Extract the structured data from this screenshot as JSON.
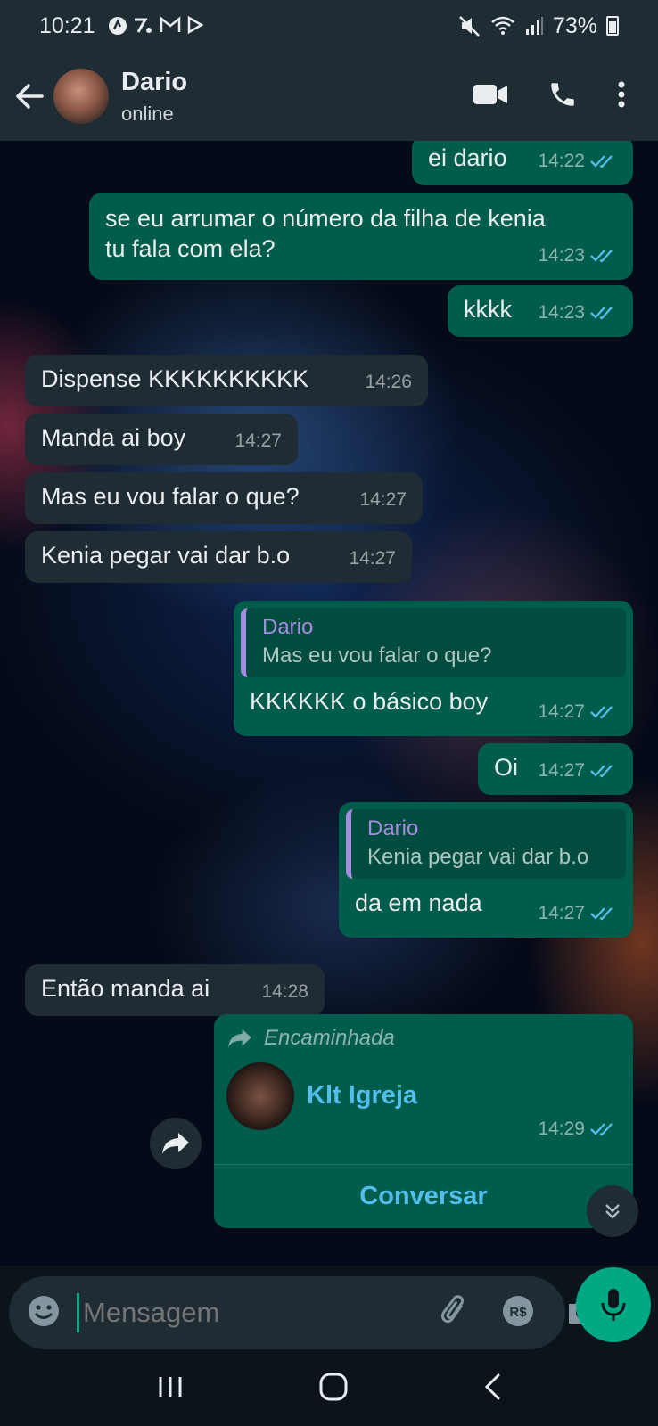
{
  "status_bar": {
    "time": "10:21",
    "battery": "73%"
  },
  "header": {
    "contact_name": "Dario",
    "contact_status": "online"
  },
  "messages": [
    {
      "dir": "out",
      "text": "ei dario",
      "time": "14:22"
    },
    {
      "dir": "out",
      "text": "se eu arrumar o número da filha de kenia\ntu fala com ela?",
      "time": "14:23"
    },
    {
      "dir": "out",
      "text": "kkkk",
      "time": "14:23"
    },
    {
      "dir": "in",
      "text": "Dispense KKKKKKKKKK",
      "time": "14:26"
    },
    {
      "dir": "in",
      "text": "Manda ai boy",
      "time": "14:27"
    },
    {
      "dir": "in",
      "text": "Mas eu vou falar o que?",
      "time": "14:27"
    },
    {
      "dir": "in",
      "text": "Kenia pegar vai dar b.o",
      "time": "14:27"
    },
    {
      "dir": "out",
      "quote_name": "Dario",
      "quote_text": "Mas eu vou falar o que?",
      "text": "KKKKKK o básico boy",
      "time": "14:27"
    },
    {
      "dir": "out",
      "text": "Oi",
      "time": "14:27"
    },
    {
      "dir": "out",
      "quote_name": "Dario",
      "quote_text": "Kenia pegar vai dar b.o",
      "text": "da em nada",
      "time": "14:27"
    },
    {
      "dir": "in",
      "text": "Então manda ai",
      "time": "14:28"
    }
  ],
  "forwarded_contact": {
    "forwarded_label": "Encaminhada",
    "contact_name": "Klt Igreja",
    "time": "14:29",
    "action_label": "Conversar"
  },
  "input": {
    "placeholder": "Mensagem"
  },
  "colors": {
    "outgoing_bubble": "#005c4b",
    "incoming_bubble": "#1f2c34",
    "accent": "#00a884",
    "read_ticks": "#53bdeb",
    "quote_accent": "#a78be2",
    "link": "#53bdeb"
  },
  "icons": [
    "back-arrow-icon",
    "video-call-icon",
    "phone-icon",
    "more-vert-icon",
    "double-tick-icon",
    "forward-icon",
    "chevron-double-down-icon",
    "emoji-icon",
    "attach-icon",
    "payment-icon",
    "camera-icon",
    "mic-icon"
  ]
}
